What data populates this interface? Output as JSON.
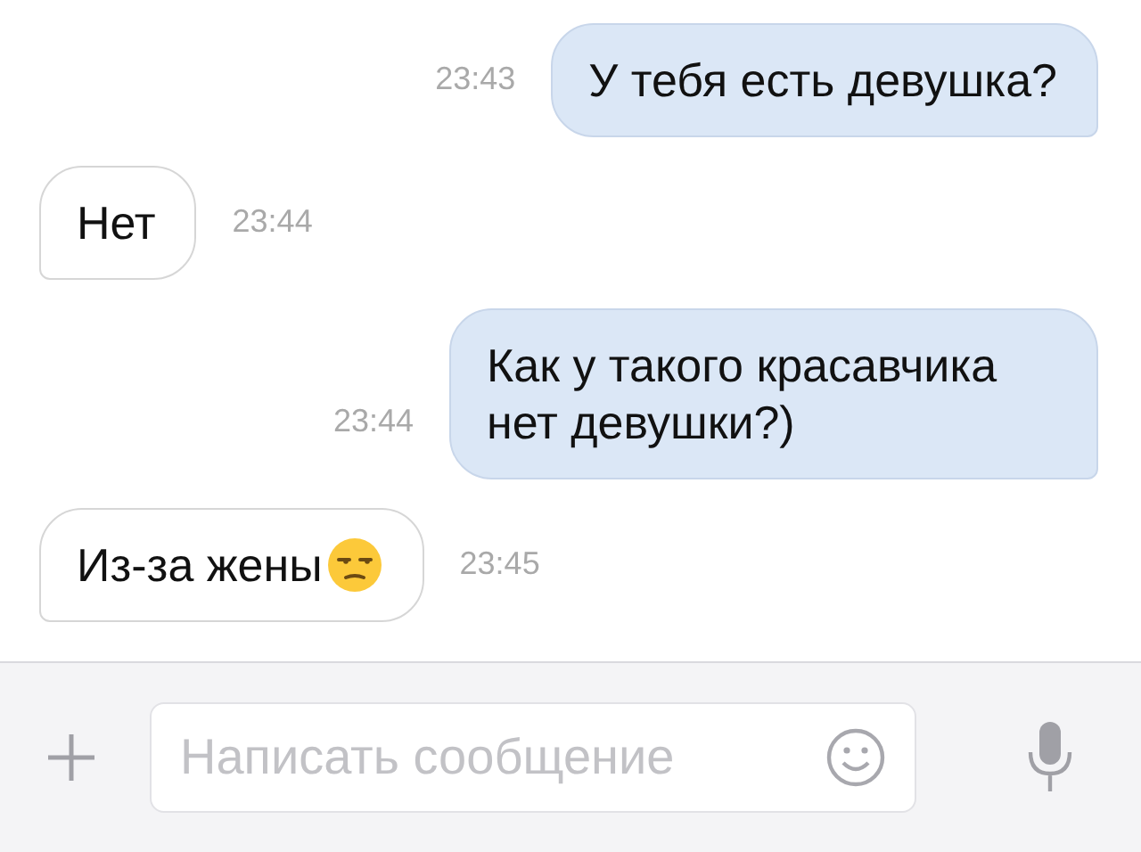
{
  "messages": [
    {
      "kind": "outgoing",
      "text": "У тебя есть девушка?",
      "time": "23:43"
    },
    {
      "kind": "incoming",
      "text": "Нет",
      "time": "23:44"
    },
    {
      "kind": "outgoing",
      "text": "Как у такого красавчика нет девушки?)",
      "time": "23:44"
    },
    {
      "kind": "incoming",
      "text": "Из-за жены",
      "emoji": true,
      "time": "23:45"
    }
  ],
  "composer": {
    "placeholder": "Написать сообщение"
  }
}
